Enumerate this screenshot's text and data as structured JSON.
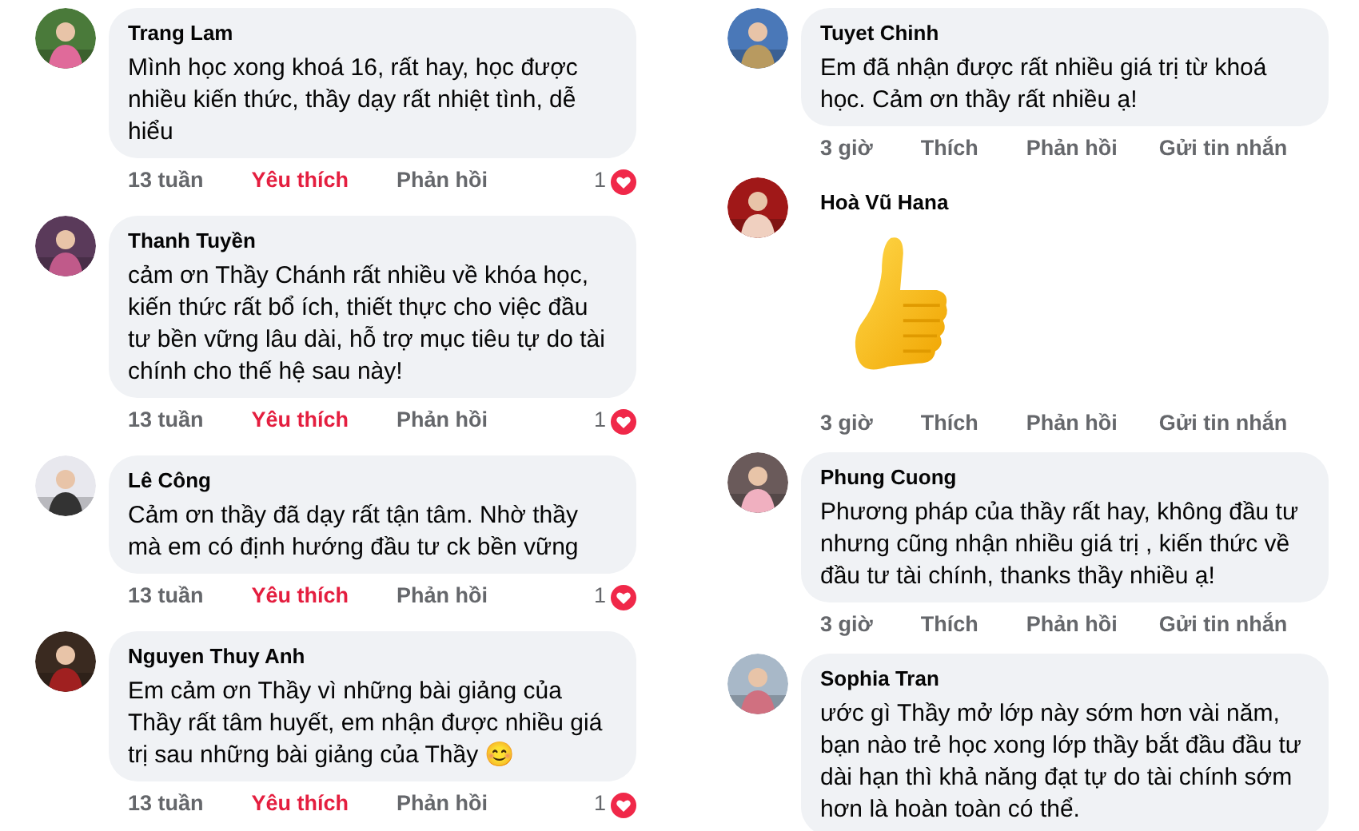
{
  "columns": [
    {
      "comments": [
        {
          "kind": "text",
          "author": "Trang Lam",
          "text": "Mình học xong khoá 16, rất hay, học được nhiều kiến thức, thầy dạy rất nhiệt tình, dễ hiểu",
          "time": "13 tuần",
          "like": "Yêu thích",
          "liked": true,
          "reply": "Phản hồi",
          "reactions": "1"
        },
        {
          "kind": "text",
          "author": "Thanh Tuyền",
          "text": "cảm ơn Thầy Chánh rất nhiều về khóa học, kiến thức rất bổ ích, thiết thực cho việc đầu tư bền vững lâu dài, hỗ trợ mục tiêu tự do tài chính cho thế hệ sau này!",
          "time": "13 tuần",
          "like": "Yêu thích",
          "liked": true,
          "reply": "Phản hồi",
          "reactions": "1"
        },
        {
          "kind": "text",
          "author": "Lê Công",
          "text": "Cảm ơn thầy đã dạy rất tận tâm. Nhờ thầy mà em có định hướng đầu tư ck bền vững",
          "time": "13 tuần",
          "like": "Yêu thích",
          "liked": true,
          "reply": "Phản hồi",
          "reactions": "1"
        },
        {
          "kind": "text",
          "author": "Nguyen Thuy Anh",
          "text": "Em cảm ơn Thầy vì những bài giảng của Thầy rất tâm huyết, em nhận được nhiều giá trị sau những bài giảng của Thầy 😊",
          "time": "13 tuần",
          "like": "Yêu thích",
          "liked": true,
          "reply": "Phản hồi",
          "reactions": "1"
        }
      ]
    },
    {
      "comments": [
        {
          "kind": "text",
          "author": "Tuyet Chinh",
          "text": "Em đã nhận được rất nhiều giá trị từ khoá học. Cảm ơn thầy rất nhiều ạ!",
          "time": "3 giờ",
          "like": "Thích",
          "liked": false,
          "reply": "Phản hồi",
          "message": "Gửi tin nhắn"
        },
        {
          "kind": "sticker",
          "author": "Hoà Vũ Hana",
          "time": "3 giờ",
          "like": "Thích",
          "liked": false,
          "reply": "Phản hồi",
          "message": "Gửi tin nhắn"
        },
        {
          "kind": "text",
          "author": "Phung Cuong",
          "text": "Phương pháp của thầy rất hay, không đầu tư nhưng cũng nhận nhiều giá trị , kiến thức về đầu tư tài chính, thanks thầy nhiều ạ!",
          "time": "3 giờ",
          "like": "Thích",
          "liked": false,
          "reply": "Phản hồi",
          "message": "Gửi tin nhắn"
        },
        {
          "kind": "text",
          "author": "Sophia Tran",
          "text": "ước gì Thầy mở lớp này sớm hơn vài năm, bạn nào trẻ học xong lớp thầy bắt đầu đầu tư dài hạn thì khả năng đạt tự do tài chính sớm hơn là hoàn toàn có thể."
        }
      ]
    }
  ]
}
